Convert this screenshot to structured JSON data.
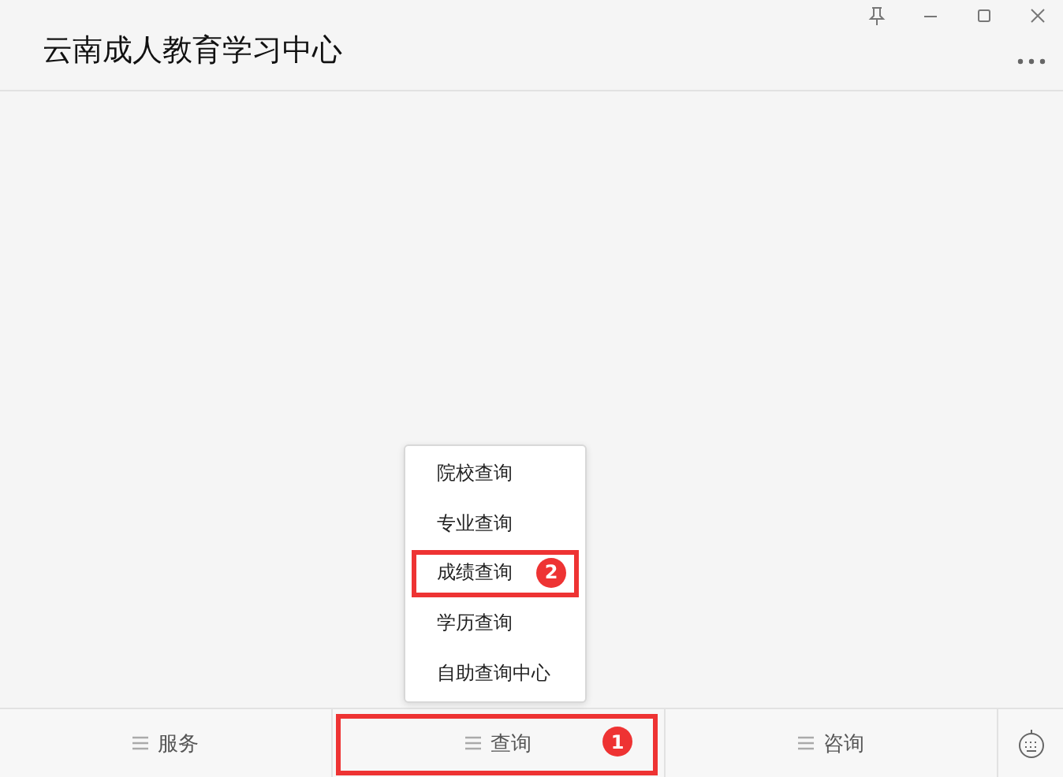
{
  "window": {
    "title": "云南成人教育学习中心"
  },
  "popup_menu": {
    "items": [
      {
        "label": "院校查询"
      },
      {
        "label": "专业查询"
      },
      {
        "label": "成绩查询",
        "annotation": "2"
      },
      {
        "label": "学历查询"
      },
      {
        "label": "自助查询中心"
      }
    ]
  },
  "bottom_menu": [
    {
      "label": "服务"
    },
    {
      "label": "查询",
      "annotation": "1"
    },
    {
      "label": "咨询"
    }
  ]
}
